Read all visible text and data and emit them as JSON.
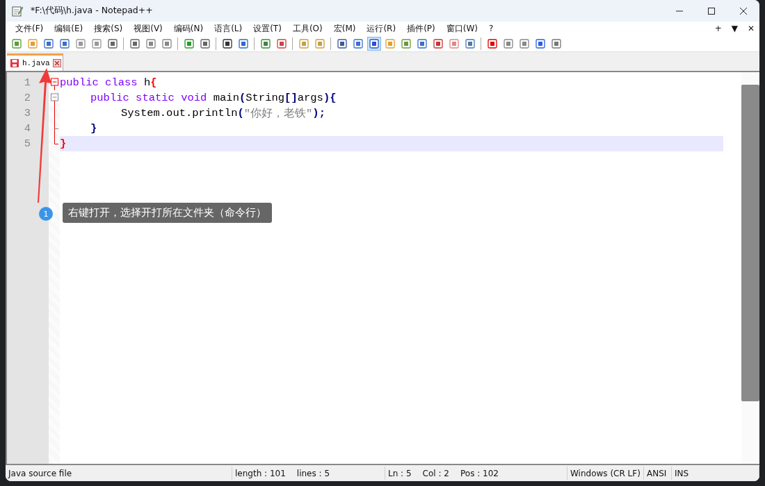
{
  "window": {
    "title": "*F:\\代码\\h.java - Notepad++"
  },
  "menu": [
    "文件(F)",
    "编辑(E)",
    "搜索(S)",
    "视图(V)",
    "编码(N)",
    "语言(L)",
    "设置(T)",
    "工具(O)",
    "宏(M)",
    "运行(R)",
    "插件(P)",
    "窗口(W)",
    "?"
  ],
  "menu_right": [
    "+",
    "▼",
    "✕"
  ],
  "toolbar": [
    [
      {
        "selected": false
      },
      {
        "selected": false
      },
      {
        "selected": false
      },
      {
        "selected": false
      },
      {
        "selected": false
      },
      {
        "selected": false
      },
      {
        "selected": false
      }
    ],
    [
      {
        "selected": false
      },
      {
        "selected": false
      },
      {
        "selected": false
      }
    ],
    [
      {
        "selected": false
      },
      {
        "selected": false
      }
    ],
    [
      {
        "selected": false
      },
      {
        "selected": false
      }
    ],
    [
      {
        "selected": false
      },
      {
        "selected": false
      }
    ],
    [
      {
        "selected": false
      },
      {
        "selected": false
      }
    ],
    [
      {
        "selected": false
      },
      {
        "selected": false
      },
      {
        "selected": true
      },
      {
        "selected": false
      },
      {
        "selected": false
      },
      {
        "selected": false
      },
      {
        "selected": false
      },
      {
        "selected": false
      },
      {
        "selected": false
      }
    ],
    [
      {
        "selected": false
      },
      {
        "selected": false
      },
      {
        "selected": false
      },
      {
        "selected": false
      },
      {
        "selected": false
      }
    ]
  ],
  "tabs": [
    {
      "label": "h.java",
      "selected": true,
      "modified": true
    }
  ],
  "code": [
    {
      "number": "1",
      "current": false,
      "tokens": [
        {
          "kind": "keyword",
          "text": "public"
        },
        {
          "kind": "keyword",
          "text": "class"
        },
        {
          "kind": "ident",
          "text": "h"
        },
        {
          "kind": "match",
          "text": "{"
        }
      ],
      "children": [
        {
          "number": "2",
          "current": false,
          "tokens": [
            {
              "kind": "keyword",
              "text": "public"
            },
            {
              "kind": "keyword",
              "text": "static"
            },
            {
              "kind": "keyword",
              "text": "void"
            },
            {
              "kind": "ident",
              "text": "main"
            },
            {
              "kind": "op",
              "text": "("
            },
            {
              "kind": "ident",
              "text": "String"
            },
            {
              "kind": "op",
              "text": "[]"
            },
            {
              "kind": "ident",
              "text": "args"
            },
            {
              "kind": "op",
              "text": "){"
            }
          ],
          "children": [
            {
              "number": "3",
              "current": false,
              "tokens": [
                {
                  "kind": "ident",
                  "text": "System.out.println"
                },
                {
                  "kind": "op",
                  "text": "("
                },
                {
                  "kind": "string",
                  "text": "\"你好，老铁\""
                },
                {
                  "kind": "op",
                  "text": ");"
                }
              ]
            }
          ]
        },
        {
          "number": "4",
          "current": false,
          "tokens": [
            {
              "kind": "op",
              "text": "}"
            }
          ]
        }
      ]
    },
    {
      "number": "5",
      "current": true,
      "tokens": [
        {
          "kind": "match",
          "text": "}"
        }
      ]
    }
  ],
  "annotation": {
    "badge": "1",
    "text": "右键打开，选择开打所在文件夹（命令行）"
  },
  "status_bar": [
    [
      "Java source file"
    ],
    [
      "length : 101",
      "lines : 5"
    ],
    [
      "Ln : 5",
      "Col : 2",
      "Pos : 102"
    ],
    [
      "Windows (CR LF)"
    ],
    [
      "ANSI"
    ],
    [
      "INS"
    ]
  ]
}
